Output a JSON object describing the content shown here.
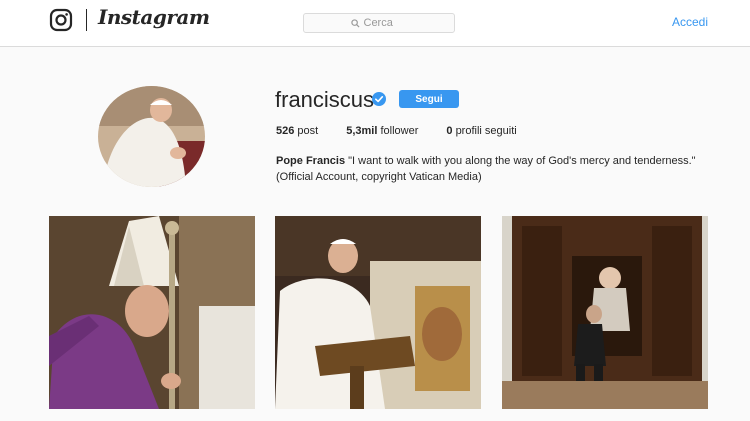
{
  "header": {
    "brand": "Instagram",
    "search_placeholder": "Cerca",
    "login_label": "Accedi"
  },
  "profile": {
    "username": "franciscus",
    "verified": true,
    "follow_label": "Segui",
    "stats": [
      {
        "value": "526",
        "label": "post"
      },
      {
        "value": "5,3mil",
        "label": "follower"
      },
      {
        "value": "0",
        "label": "profili seguiti"
      }
    ],
    "bio_name": "Pope Francis",
    "bio_text": "\"I want to walk with you along the way of God's mercy and tenderness.\"",
    "bio_line2": "(Official Account, copyright Vatican Media)"
  },
  "colors": {
    "accent": "#3897f0",
    "text": "#262626",
    "background": "#fafafa"
  },
  "icons": [
    "instagram-camera-icon",
    "search-icon",
    "verified-badge-icon"
  ]
}
